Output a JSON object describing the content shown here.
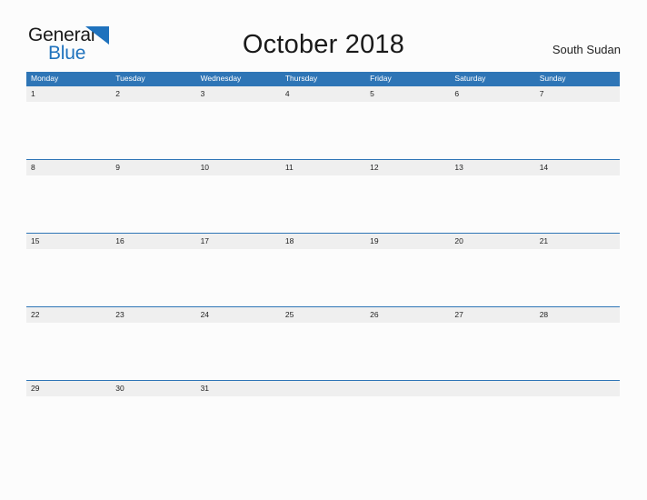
{
  "brand": {
    "name_part1": "General",
    "name_part2": "Blue",
    "mark": "blue-triangle-logo-icon"
  },
  "header": {
    "title": "October 2018",
    "region": "South Sudan"
  },
  "calendar": {
    "weekdays": [
      "Monday",
      "Tuesday",
      "Wednesday",
      "Thursday",
      "Friday",
      "Saturday",
      "Sunday"
    ],
    "weeks": [
      [
        "1",
        "2",
        "3",
        "4",
        "5",
        "6",
        "7"
      ],
      [
        "8",
        "9",
        "10",
        "11",
        "12",
        "13",
        "14"
      ],
      [
        "15",
        "16",
        "17",
        "18",
        "19",
        "20",
        "21"
      ],
      [
        "22",
        "23",
        "24",
        "25",
        "26",
        "27",
        "28"
      ],
      [
        "29",
        "30",
        "31",
        "",
        "",
        "",
        ""
      ]
    ]
  },
  "colors": {
    "header_blue": "#2E75B6",
    "band_gray": "#EFEFEF",
    "brand_blue": "#1F72BD",
    "page_background": "#FCFCFC"
  }
}
